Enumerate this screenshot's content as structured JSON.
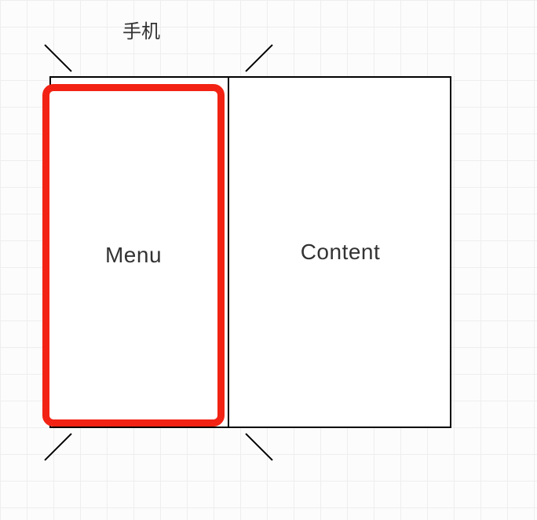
{
  "frame": {
    "label": "手机"
  },
  "panels": {
    "menu_label": "Menu",
    "content_label": "Content"
  },
  "highlight": {
    "target": "menu",
    "color": "#f22314"
  }
}
